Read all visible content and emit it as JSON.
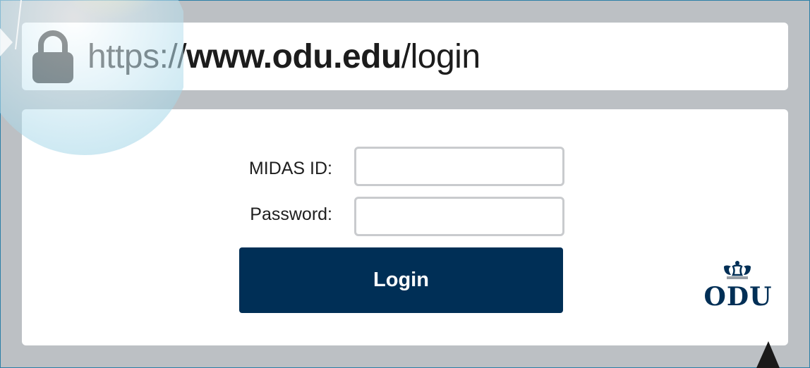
{
  "address_bar": {
    "scheme": "https://",
    "domain": "www.odu.edu",
    "path": "/login"
  },
  "login_form": {
    "midas_label": "MIDAS ID:",
    "midas_value": "",
    "password_label": "Password:",
    "password_value": "",
    "login_button": "Login"
  },
  "logo": {
    "text": "ODU",
    "icon": "crown-icon"
  },
  "icons": [
    "lock-icon",
    "crown-icon",
    "cursor-icon"
  ],
  "colors": {
    "background": "#bcc0c4",
    "button": "#002f56",
    "logo": "#002f56",
    "input_border": "#c9cbce"
  }
}
